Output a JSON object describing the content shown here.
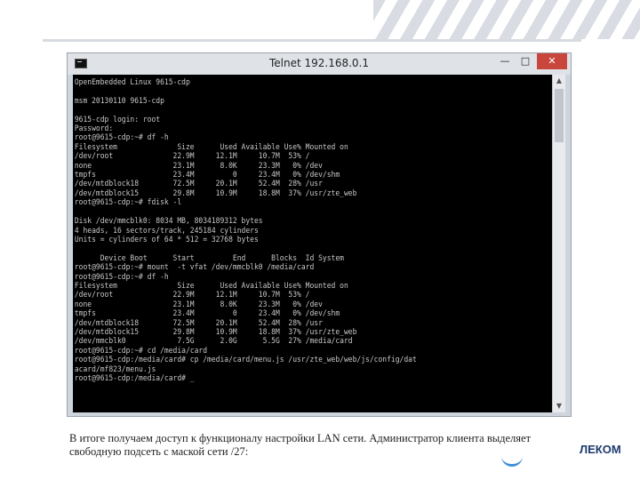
{
  "window": {
    "title": "Telnet 192.168.0.1",
    "controls": {
      "minimize": "—",
      "maximize": "□",
      "close": "✕"
    }
  },
  "console": {
    "lines": [
      "OpenEmbedded Linux 9615-cdp",
      "",
      "msm 20130110 9615-cdp",
      "",
      "9615-cdp login: root",
      "Password:",
      "root@9615-cdp:~# df -h",
      "Filesystem              Size      Used Available Use% Mounted on",
      "/dev/root              22.9M     12.1M     10.7M  53% /",
      "none                   23.1M      8.0K     23.3M   0% /dev",
      "tmpfs                  23.4M         0     23.4M   0% /dev/shm",
      "/dev/mtdblock18        72.5M     20.1M     52.4M  28% /usr",
      "/dev/mtdblock15        29.8M     10.9M     18.8M  37% /usr/zte_web",
      "root@9615-cdp:~# fdisk -l",
      "",
      "Disk /dev/mmcblk0: 8034 MB, 8034189312 bytes",
      "4 heads, 16 sectors/track, 245184 cylinders",
      "Units = cylinders of 64 * 512 = 32768 bytes",
      "",
      "      Device Boot      Start         End      Blocks  Id System",
      "root@9615-cdp:~# mount  -t vfat /dev/mmcblk0 /media/card",
      "root@9615-cdp:~# df -h",
      "Filesystem              Size      Used Available Use% Mounted on",
      "/dev/root              22.9M     12.1M     10.7M  53% /",
      "none                   23.1M      8.0K     23.3M   0% /dev",
      "tmpfs                  23.4M         0     23.4M   0% /dev/shm",
      "/dev/mtdblock18        72.5M     20.1M     52.4M  28% /usr",
      "/dev/mtdblock15        29.8M     10.9M     18.8M  37% /usr/zte_web",
      "/dev/mmcblk0            7.5G      2.0G      5.5G  27% /media/card",
      "root@9615-cdp:~# cd /media/card",
      "root@9615-cdp:/media/card# cp /media/card/menu.js /usr/zte_web/web/js/config/dat",
      "acard/mf823/menu.js",
      "root@9615-cdp:/media/card# _"
    ]
  },
  "caption": {
    "line1": "В итоге получаем доступ к функционалу настройки LAN сети. Администратор клиента выделяет",
    "line2": "свободную подсеть с маской сети /27:"
  },
  "brand": {
    "text": "ЛЕКОМ"
  },
  "icons": {
    "app": "console-app-icon",
    "scroll_up": "▲",
    "scroll_down": "▼"
  }
}
